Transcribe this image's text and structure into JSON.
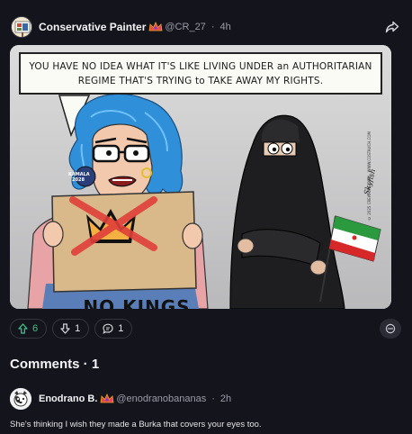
{
  "post": {
    "author": "Conservative Painter",
    "handle": "@CR_27",
    "separator": "·",
    "time": "4h"
  },
  "cartoon": {
    "caption_line1": "YOU HAVE NO IDEA WHAT IT'S LIKE LIVING UNDER an AUTHORITARIAN",
    "caption_line2": "REGIME THAT'S TRYING to TAKE AWAY MY RIGHTS.",
    "sign_text": "NO KINGS",
    "pin_line1": "KAMALA",
    "pin_line2": "2028",
    "credit": "© 2025 CREATORS.COM · WWW.COSTAUCH.COM",
    "signature": "Skyfish"
  },
  "actions": {
    "upvotes": "6",
    "downvotes": "1",
    "comments": "1"
  },
  "comments_section": {
    "title": "Comments · 1"
  },
  "comment": {
    "author": "Enodrano B.",
    "handle": "@enodranobananas",
    "separator": "·",
    "time": "2h",
    "text": "She's thinking I wish they made a Burka that covers your eyes too."
  },
  "colors": {
    "background": "#14151c",
    "upvote_accent": "#39c28a",
    "pill_border": "#34353f"
  },
  "icons": [
    "crown-badge-icon",
    "share-icon",
    "upvote-icon",
    "downvote-icon",
    "comment-icon",
    "more-options-icon"
  ]
}
